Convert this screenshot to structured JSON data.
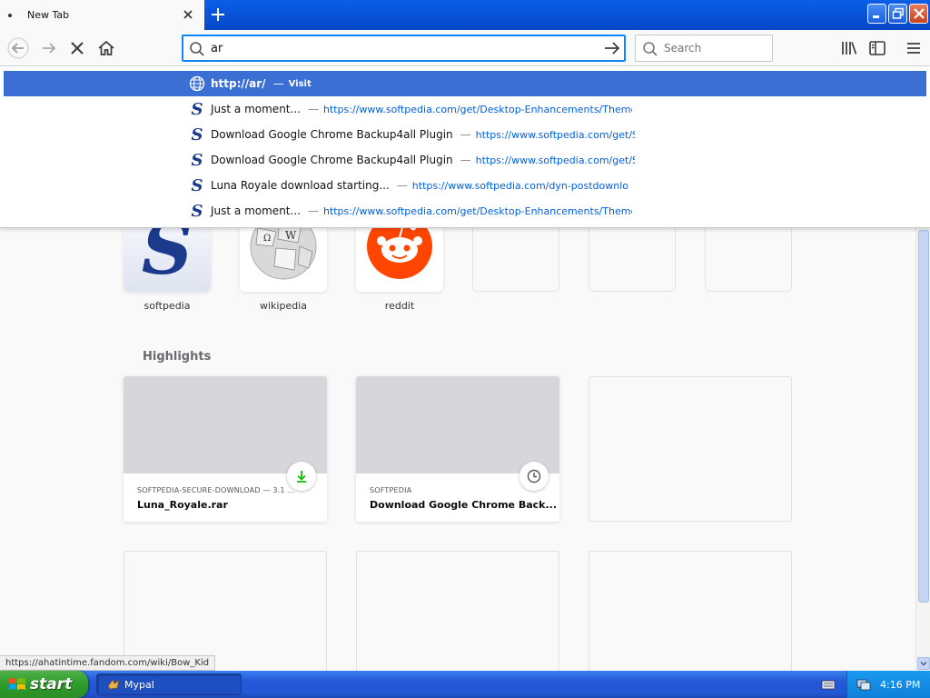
{
  "tab": {
    "title": "New Tab"
  },
  "urlbar": {
    "value": "ar"
  },
  "searchbar": {
    "placeholder": "Search"
  },
  "popup": {
    "rows": [
      {
        "title": "http://ar/",
        "url": "Visit"
      },
      {
        "title": "Just a moment...",
        "url": "https://www.softpedia.com/get/Desktop-Enhancements/Themes/Lu"
      },
      {
        "title": "Download Google Chrome Backup4all Plugin",
        "url": "https://www.softpedia.com/get/Sys"
      },
      {
        "title": "Download Google Chrome Backup4all Plugin",
        "url": "https://www.softpedia.com/get/Sys"
      },
      {
        "title": "Luna Royale download starting...",
        "url": "https://www.softpedia.com/dyn-postdownload.p"
      },
      {
        "title": "Just a moment...",
        "url": "https://www.softpedia.com/get/Desktop-Enhancements/Themes/Lu"
      }
    ],
    "separator": "—"
  },
  "top_sites": [
    {
      "label": "softpedia"
    },
    {
      "label": "wikipedia"
    },
    {
      "label": "reddit"
    }
  ],
  "highlights": {
    "title": "Highlights",
    "cards": [
      {
        "context": "SOFTPEDIA-SECURE-DOWNLOAD — 3.1 ...",
        "title": "Luna_Royale.rar",
        "badge": "download-icon"
      },
      {
        "context": "SOFTPEDIA",
        "title": "Download Google Chrome Back...",
        "badge": "clock-icon"
      }
    ]
  },
  "status_text": "https://ahatintime.fandom.com/wiki/Bow_Kid",
  "taskbar": {
    "start_label": "start",
    "task_label": "Mypal",
    "clock": "4:16 PM"
  },
  "colors": {
    "accent": "#0a84ff",
    "selected_row": "#3b6fd4",
    "reddit": "#ff4500",
    "softpedia": "#1b3a8c"
  }
}
